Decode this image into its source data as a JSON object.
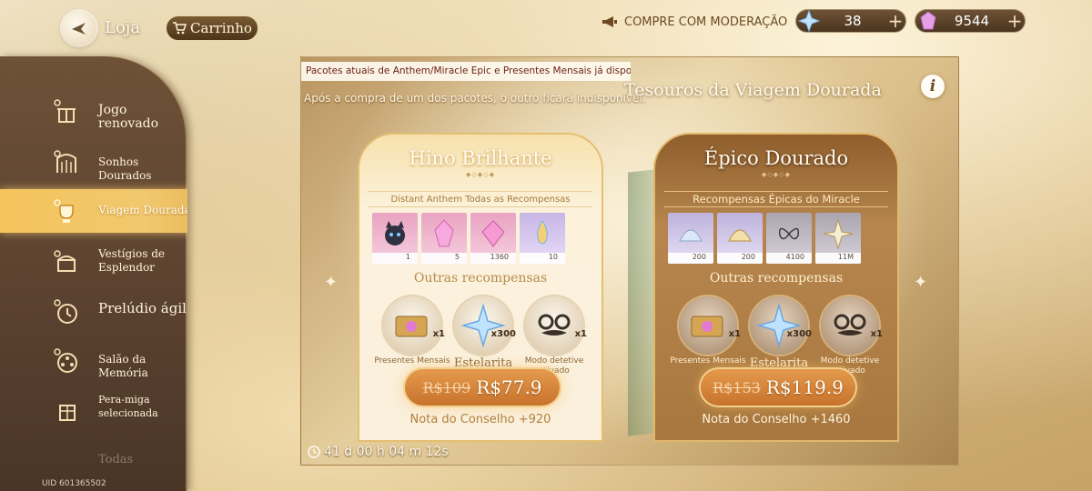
{
  "header": {
    "title": "Loja",
    "cart_label": "Carrinho",
    "moderation_notice": "COMPRE COM MODERAÇÃO",
    "currencies": [
      {
        "icon": "stellarite-icon",
        "value": "38"
      },
      {
        "icon": "gem-icon",
        "value": "9544"
      }
    ]
  },
  "sidebar": {
    "items": [
      {
        "label": "Jogo renovado",
        "active": false
      },
      {
        "label": "Sonhos Dourados",
        "active": false
      },
      {
        "label": "Viagem Dourada",
        "active": true
      },
      {
        "label": "Vestígios de Esplendor",
        "active": false
      },
      {
        "label": "Prelúdio ágil",
        "active": false
      },
      {
        "label": "Salão da Memória",
        "active": false
      },
      {
        "label": "Pera-miga selecionada",
        "active": false
      },
      {
        "label": "Todas",
        "active": false
      }
    ],
    "uid": "UID 601365502"
  },
  "main": {
    "banner": "Pacotes atuais de Anthem/Miracle Epic e Presentes Mensais já disponíveis!",
    "warning": "Após a compra de um dos pacotes, o outro ficará indisponível.",
    "event_title": "Tesouros da Viagem Dourada",
    "info_label": "i",
    "timer": "41 d 00 h 04 m 12s"
  },
  "packages": [
    {
      "title": "Hino Brilhante",
      "section_label": "Distant Anthem Todas as Recompensas",
      "rewards": [
        "1",
        "5",
        "1360",
        "10"
      ],
      "other_label": "Outras recompensas",
      "others": [
        {
          "name": "Presentes Mensais",
          "qty": "x1"
        },
        {
          "name": "Estelarita",
          "qty": "x300"
        },
        {
          "name": "Modo detetive ativado",
          "qty": "x1"
        }
      ],
      "price_old": "R$109",
      "price_new": "R$77.9",
      "council_note": "Nota do Conselho +920"
    },
    {
      "title": "Épico Dourado",
      "section_label": "Recompensas Épicas do Miracle",
      "rewards": [
        "200",
        "200",
        "4100",
        "11M"
      ],
      "other_label": "Outras recompensas",
      "others": [
        {
          "name": "Presentes Mensais",
          "qty": "x1"
        },
        {
          "name": "Estelarita",
          "qty": "x300"
        },
        {
          "name": "Modo detetive ativado",
          "qty": "x1"
        }
      ],
      "price_old": "R$153",
      "price_new": "R$119.9",
      "council_note": "Nota do Conselho +1460"
    }
  ],
  "colors": {
    "sidebar": "#5b4230",
    "active_tab": "#f4c45b",
    "price_button": "#d3813a",
    "banner_text": "#6a1e12"
  }
}
